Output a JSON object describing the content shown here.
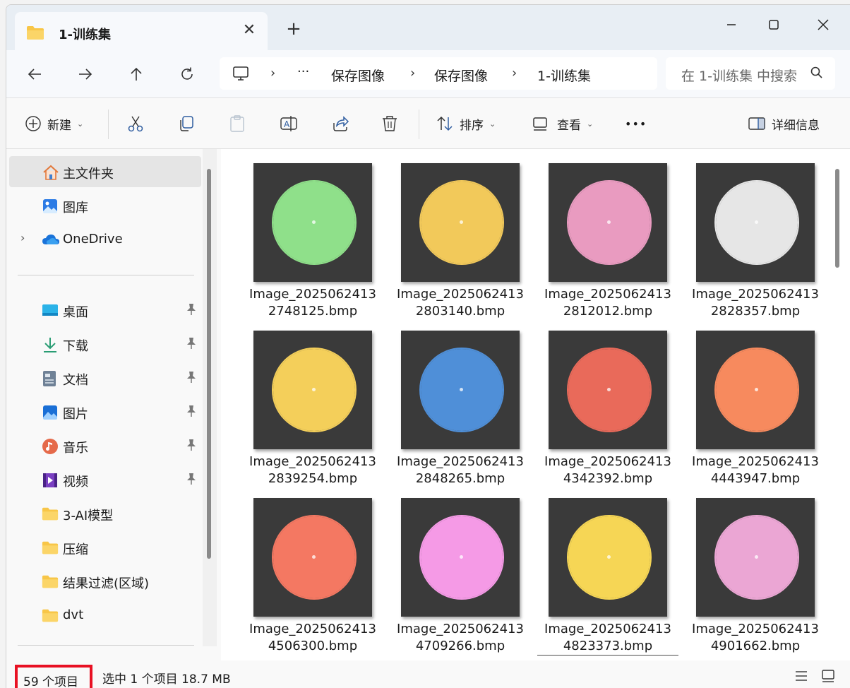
{
  "tab": {
    "title": "1-训练集"
  },
  "address": {
    "crumbs": [
      "保存图像",
      "保存图像",
      "1-训练集"
    ],
    "more": "···"
  },
  "search": {
    "placeholder": "在 1-训练集 中搜索"
  },
  "toolbar": {
    "new_label": "新建",
    "sort_label": "排序",
    "view_label": "查看",
    "more_label": "•••",
    "details_label": "详细信息"
  },
  "sidebar": {
    "items": [
      {
        "label": "主文件夹",
        "icon": "home-icon"
      },
      {
        "label": "图库",
        "icon": "gallery-icon"
      },
      {
        "label": "OneDrive",
        "icon": "cloud-icon"
      },
      {
        "label": "桌面",
        "icon": "desktop-icon"
      },
      {
        "label": "下载",
        "icon": "download-icon"
      },
      {
        "label": "文档",
        "icon": "document-icon"
      },
      {
        "label": "图片",
        "icon": "pictures-icon"
      },
      {
        "label": "音乐",
        "icon": "music-icon"
      },
      {
        "label": "视频",
        "icon": "video-icon"
      },
      {
        "label": "3-AI模型",
        "icon": "folder-icon"
      },
      {
        "label": "压缩",
        "icon": "folder-icon"
      },
      {
        "label": "结果过滤(区域)",
        "icon": "folder-icon"
      },
      {
        "label": "dvt",
        "icon": "folder-icon"
      }
    ]
  },
  "files": [
    {
      "name": "Image_2025062413\n2748125.bmp",
      "color": "#8fe08a"
    },
    {
      "name": "Image_2025062413\n2803140.bmp",
      "color": "#f2c95a"
    },
    {
      "name": "Image_2025062413\n2812012.bmp",
      "color": "#e99bc0"
    },
    {
      "name": "Image_2025062413\n2828357.bmp",
      "color": "#e6e6e6"
    },
    {
      "name": "Image_2025062413\n2839254.bmp",
      "color": "#f4cf5a"
    },
    {
      "name": "Image_2025062413\n2848265.bmp",
      "color": "#4f8fd8"
    },
    {
      "name": "Image_2025062413\n4342392.bmp",
      "color": "#e96a5a"
    },
    {
      "name": "Image_2025062413\n4443947.bmp",
      "color": "#f78a5e"
    },
    {
      "name": "Image_2025062413\n4506300.bmp",
      "color": "#f47862"
    },
    {
      "name": "Image_2025062413\n4709266.bmp",
      "color": "#f59ae6"
    },
    {
      "name": "Image_2025062413\n4823373.bmp",
      "color": "#f6d655"
    },
    {
      "name": "Image_2025062413\n4901662.bmp",
      "color": "#eba6d4"
    }
  ],
  "status": {
    "count": "59 个项目",
    "selection": "选中 1 个项目  18.7 MB"
  }
}
